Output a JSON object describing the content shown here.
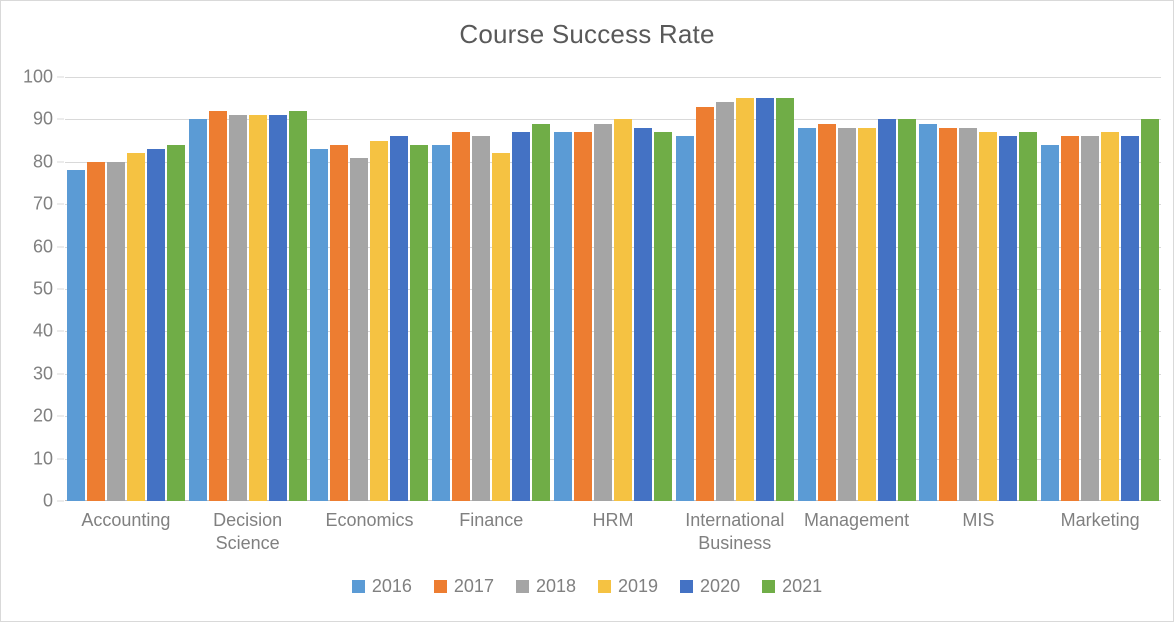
{
  "chart_data": {
    "type": "bar",
    "title": "Course Success Rate",
    "xlabel": "",
    "ylabel": "",
    "ylim": [
      0,
      100
    ],
    "ytick_step": 10,
    "yticks": [
      "100",
      "90",
      "80",
      "70",
      "60",
      "50",
      "40",
      "30",
      "20",
      "10",
      "0"
    ],
    "grid": true,
    "legend_position": "bottom",
    "categories": [
      "Accounting",
      "Decision Science",
      "Economics",
      "Finance",
      "HRM",
      "International Business",
      "Management",
      "MIS",
      "Marketing"
    ],
    "series": [
      {
        "name": "2016",
        "color": "#5b9bd5",
        "values": [
          78,
          90,
          83,
          84,
          87,
          86,
          88,
          89,
          84
        ]
      },
      {
        "name": "2017",
        "color": "#ed7d31",
        "values": [
          80,
          92,
          84,
          87,
          87,
          93,
          89,
          88,
          86
        ]
      },
      {
        "name": "2018",
        "color": "#a5a5a5",
        "values": [
          80,
          91,
          81,
          86,
          89,
          94,
          88,
          88,
          86
        ]
      },
      {
        "name": "2019",
        "color": "#f5c242",
        "values": [
          82,
          91,
          85,
          82,
          90,
          95,
          88,
          87,
          87
        ]
      },
      {
        "name": "2020",
        "color": "#4472c4",
        "values": [
          83,
          91,
          86,
          87,
          88,
          95,
          90,
          86,
          86
        ]
      },
      {
        "name": "2021",
        "color": "#70ad47",
        "values": [
          84,
          92,
          84,
          89,
          87,
          95,
          90,
          87,
          90
        ]
      }
    ]
  },
  "colors": {
    "grid": "#d9d9d9",
    "axis_text": "#808080",
    "title_text": "#595959",
    "border": "#d9d9d9",
    "background": "#ffffff"
  }
}
